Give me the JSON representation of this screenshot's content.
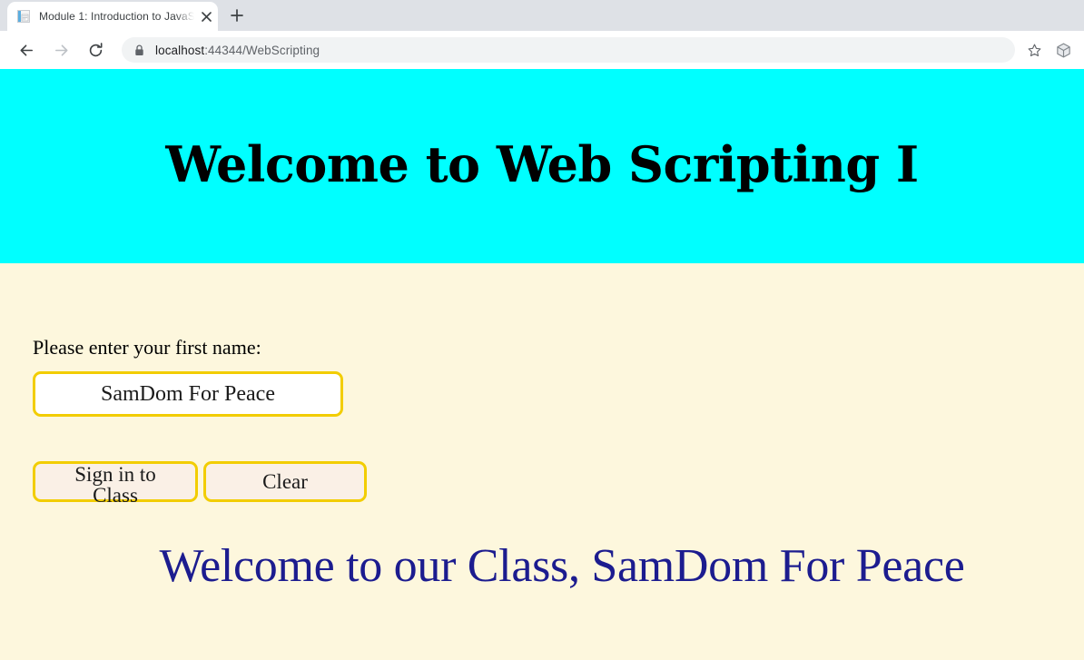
{
  "browser": {
    "tab": {
      "title": "Module 1: Introduction to JavaSc",
      "favicon": "document-icon",
      "close_label": "✕"
    },
    "new_tab_label": "+",
    "nav": {
      "back": "back-arrow-icon",
      "forward": "forward-arrow-icon",
      "reload": "reload-icon"
    },
    "address_bar": {
      "lock": "lock-icon",
      "host": "localhost",
      "path": ":44344/WebScripting",
      "full_url": "localhost:44344/WebScripting"
    },
    "actions": {
      "bookmark": "star-icon",
      "extensions": "cube-icon"
    }
  },
  "page": {
    "header": {
      "title": "Welcome to Web Scripting I",
      "background_color": "#00ffff",
      "text_color": "#000000"
    },
    "body": {
      "background_color": "#fdf7dd",
      "label": "Please enter your first name:",
      "input": {
        "value": "SamDom For Peace",
        "placeholder": "",
        "border_color": "#f2cd00",
        "background_color": "#ffffff"
      },
      "buttons": [
        {
          "label": "Sign in to Class",
          "border_color": "#f2cd00",
          "background_color": "#faf0e6"
        },
        {
          "label": "Clear",
          "border_color": "#f2cd00",
          "background_color": "#faf0e6"
        }
      ],
      "message": "Welcome to our Class, SamDom For Peace",
      "message_color": "#1c1c8f"
    }
  }
}
